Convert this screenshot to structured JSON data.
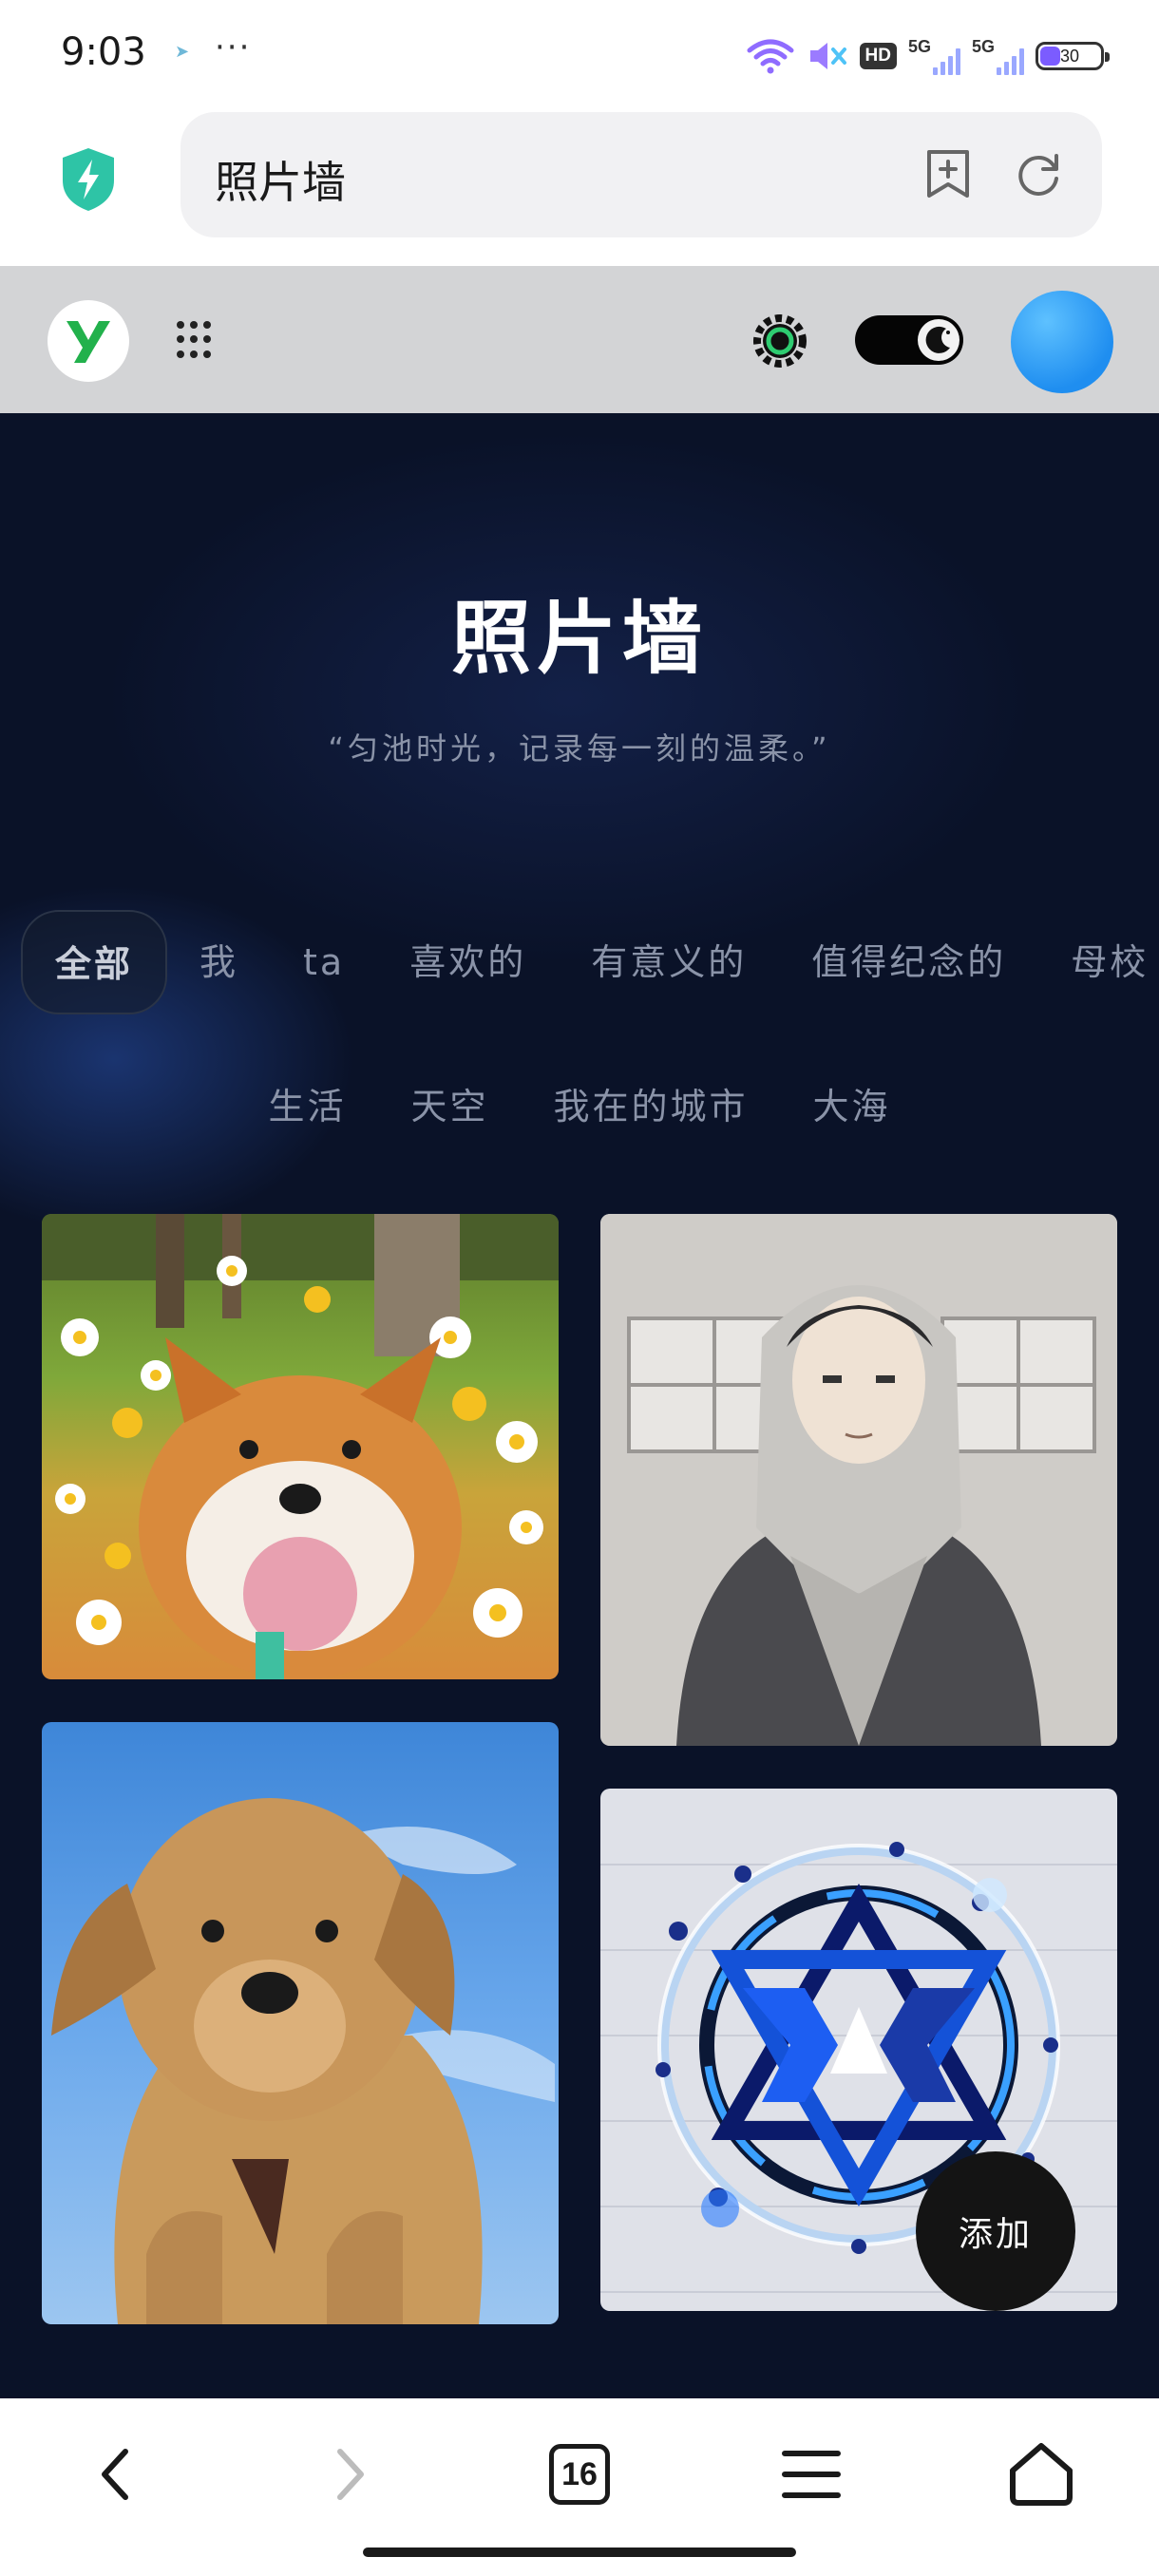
{
  "status_bar": {
    "time": "9:03",
    "dots": "···",
    "hd_label": "HD",
    "net1_label": "5G",
    "net2_label": "5G",
    "battery": "30"
  },
  "browser": {
    "url_text": "照片墙",
    "icons": [
      "shield-icon",
      "add-bookmark-icon",
      "reload-icon"
    ]
  },
  "site_nav": {
    "logo_letter": "Y",
    "colors": {
      "logo": "#22b14c",
      "avatar": "#2f9bf5"
    }
  },
  "hero": {
    "title": "照片墙",
    "subtitle": "“匀池时光，记录每一刻的温柔。”"
  },
  "tabs": {
    "row1": [
      "全部",
      "我",
      "ta",
      "喜欢的",
      "有意义的",
      "值得纪念的",
      "母校"
    ],
    "row2": [
      "生活",
      "天空",
      "我在的城市",
      "大海"
    ],
    "active": "全部"
  },
  "photos": [
    {
      "subject": "shiba-dog-with-daisies"
    },
    {
      "subject": "anime-boy-in-hoodie"
    },
    {
      "subject": "golden-retriever-puppy-sky"
    },
    {
      "subject": "yax-logo-emblem"
    }
  ],
  "add_button_label": "添加",
  "bottom_nav": {
    "tab_count": "16"
  }
}
